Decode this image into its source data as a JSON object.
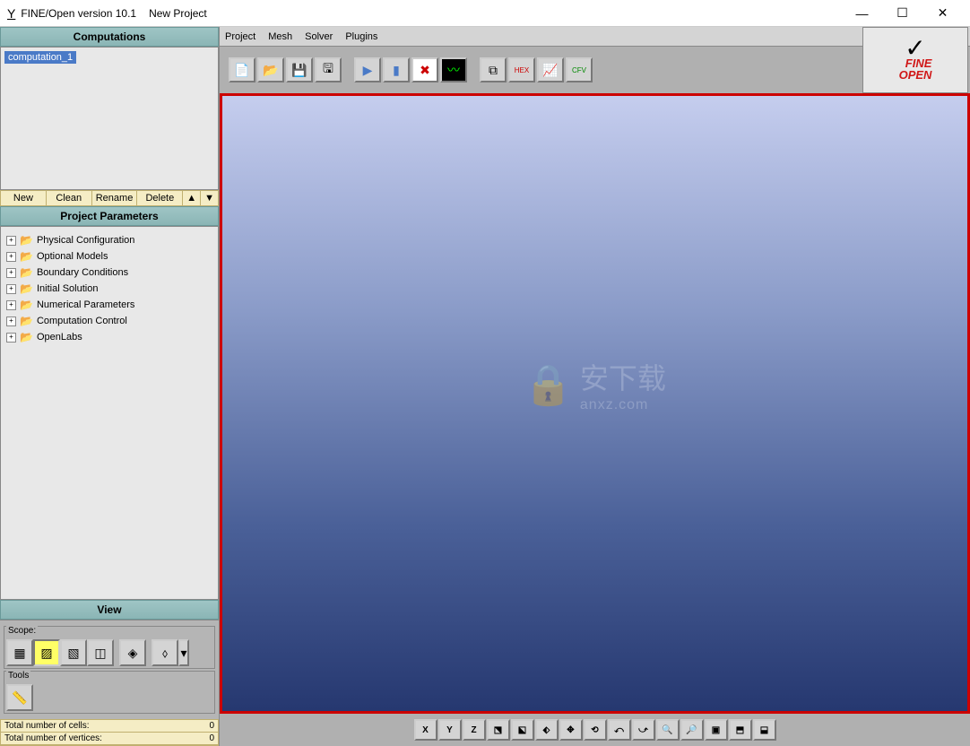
{
  "window": {
    "app_icon": "Y",
    "title": "FINE/Open version 10.1",
    "project": "New Project",
    "min": "—",
    "max": "☐",
    "close": "✕"
  },
  "menubar": [
    "Project",
    "Mesh",
    "Solver",
    "Plugins"
  ],
  "logo": {
    "line1": "FINE",
    "line2": "OPEN"
  },
  "sidebar": {
    "computations": {
      "title": "Computations",
      "items": [
        "computation_1"
      ],
      "buttons": [
        "New",
        "Clean",
        "Rename",
        "Delete"
      ],
      "up": "▲",
      "down": "▼"
    },
    "project_params": {
      "title": "Project Parameters",
      "tree": [
        "Physical Configuration",
        "Optional Models",
        "Boundary Conditions",
        "Initial Solution",
        "Numerical Parameters",
        "Computation Control",
        "OpenLabs"
      ]
    },
    "view": {
      "title": "View",
      "scope_label": "Scope:",
      "tools_label": "Tools"
    },
    "status": {
      "cells_label": "Total number of cells:",
      "cells_value": "0",
      "vertices_label": "Total number of vertices:",
      "vertices_value": "0"
    }
  },
  "watermark": {
    "text": "安下载",
    "sub": "anxz.com"
  },
  "bottom_buttons": [
    "X",
    "Y",
    "Z"
  ]
}
